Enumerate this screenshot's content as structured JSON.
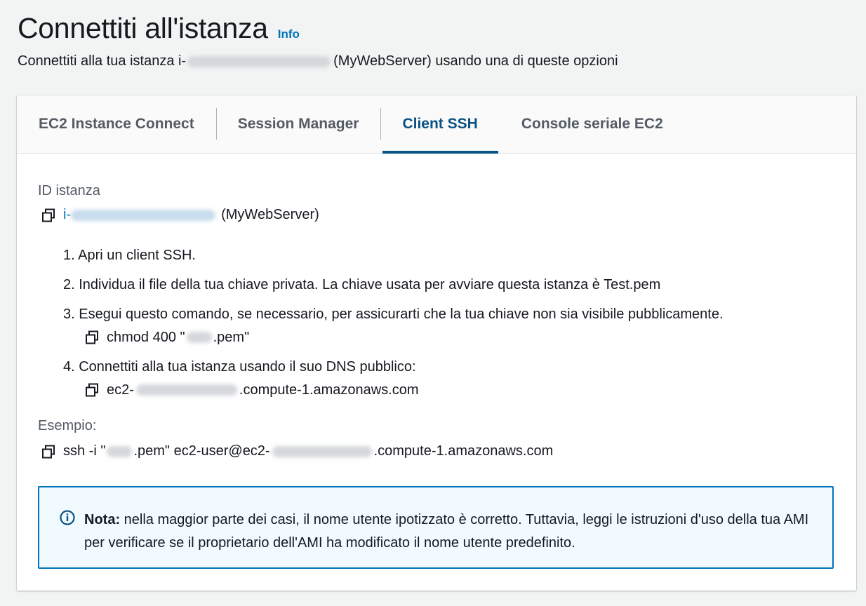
{
  "header": {
    "title": "Connettiti all'istanza",
    "info_link": "Info",
    "subtitle_prefix": "Connettiti alla tua istanza i-",
    "subtitle_suffix": "(MyWebServer) usando una di queste opzioni"
  },
  "tabs": [
    {
      "label": "EC2 Instance Connect",
      "active": false
    },
    {
      "label": "Session Manager",
      "active": false
    },
    {
      "label": "Client SSH",
      "active": true
    },
    {
      "label": "Console seriale EC2",
      "active": false
    }
  ],
  "instance": {
    "label": "ID istanza",
    "id_prefix": "i-",
    "name": "(MyWebServer)"
  },
  "steps": {
    "s1": "1. Apri un client SSH.",
    "s2": "2. Individua il file della tua chiave privata. La chiave usata per avviare questa istanza è Test.pem",
    "s3": "3. Esegui questo comando, se necessario, per assicurarti che la tua chiave non sia visibile pubblicamente.",
    "s3_cmd_prefix": "chmod 400 \"",
    "s3_cmd_suffix": ".pem\"",
    "s4": "4. Connettiti alla tua istanza usando il suo DNS pubblico:",
    "s4_dns_prefix": "ec2-",
    "s4_dns_suffix": ".compute-1.amazonaws.com"
  },
  "example": {
    "label": "Esempio:",
    "cmd_prefix": "ssh -i \"",
    "cmd_middle": ".pem\" ec2-user@ec2-",
    "cmd_suffix": ".compute-1.amazonaws.com"
  },
  "note": {
    "bold": "Nota:",
    "text": " nella maggior parte dei casi, il nome utente ipotizzato è corretto. Tuttavia, leggi le istruzioni d'uso della tua AMI per verificare se il proprietario dell'AMI ha modificato il nome utente predefinito."
  },
  "colors": {
    "accent": "#0073bb",
    "active_tab": "#0a5185",
    "note_bg": "#f1faff"
  }
}
